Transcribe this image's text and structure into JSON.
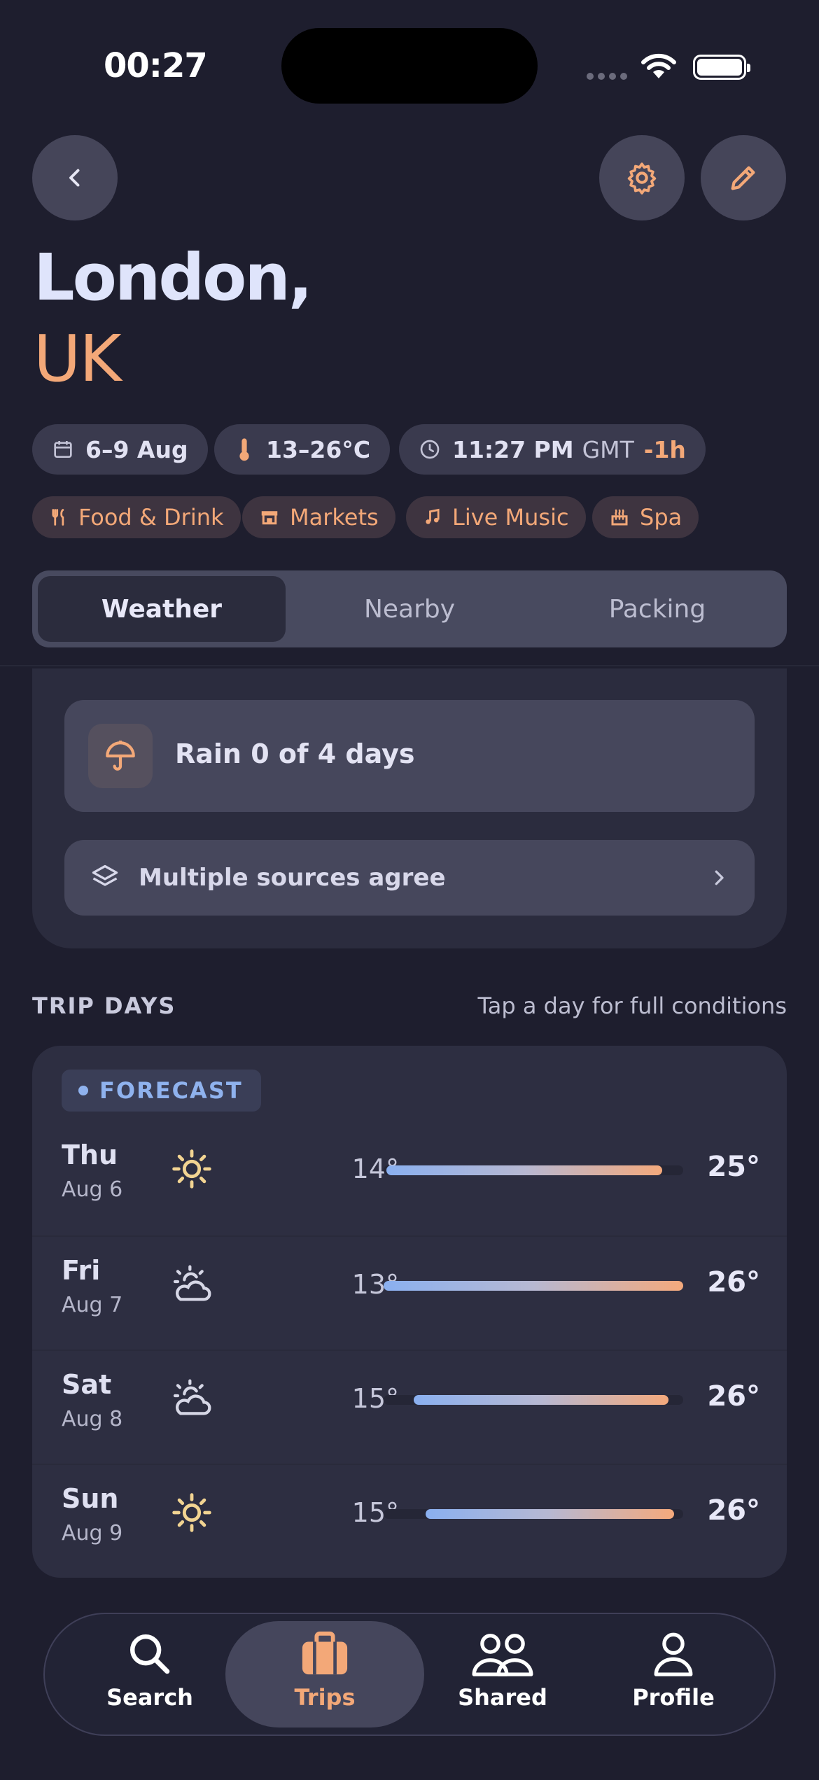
{
  "status_bar": {
    "time": "00:27"
  },
  "header": {
    "city": "London,",
    "country": "UK"
  },
  "chips": {
    "dates": "6–9 Aug",
    "temp_range": "13–26°C",
    "local_time": "11:27 PM",
    "timezone": "GMT",
    "offset": "-1h"
  },
  "tags": [
    "Food & Drink",
    "Markets",
    "Live Music",
    "Spa"
  ],
  "tabs": [
    "Weather",
    "Nearby",
    "Packing"
  ],
  "summary": {
    "rain": "Rain 0 of 4 days",
    "sources": "Multiple sources agree"
  },
  "trip_days": {
    "title": "TRIP DAYS",
    "hint": "Tap a day for full conditions",
    "badge": "FORECAST",
    "days": [
      {
        "name": "Thu",
        "date": "Aug 6",
        "icon": "sun-icon",
        "low": "14°",
        "high": "25°",
        "bar_start": 0.01,
        "bar_end": 0.93
      },
      {
        "name": "Fri",
        "date": "Aug 7",
        "icon": "partly-cloudy-icon",
        "low": "13°",
        "high": "26°",
        "bar_start": 0.0,
        "bar_end": 1.0
      },
      {
        "name": "Sat",
        "date": "Aug 8",
        "icon": "partly-cloudy-icon",
        "low": "15°",
        "high": "26°",
        "bar_start": 0.1,
        "bar_end": 0.95
      },
      {
        "name": "Sun",
        "date": "Aug 9",
        "icon": "sun-icon",
        "low": "15°",
        "high": "26°",
        "bar_start": 0.14,
        "bar_end": 0.97
      }
    ]
  },
  "tab_bar": {
    "items": [
      "Search",
      "Trips",
      "Shared",
      "Profile"
    ],
    "active": "Trips"
  },
  "colors": {
    "accent": "#f3a878",
    "forecast_blue": "#8fb2ee",
    "background": "#1e1e2e"
  }
}
